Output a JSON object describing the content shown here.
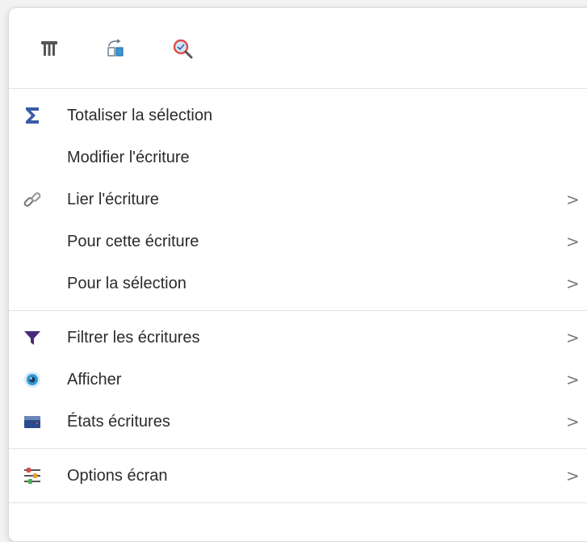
{
  "toolbar": {
    "buttons": [
      {
        "icon": "column-icon"
      },
      {
        "icon": "document-sync-icon"
      },
      {
        "icon": "search-magnifier-icon"
      }
    ]
  },
  "menu": {
    "sections": [
      {
        "items": [
          {
            "label": "Totaliser la sélection",
            "icon": "sigma-icon",
            "submenu": false
          },
          {
            "label": "Modifier l'écriture",
            "icon": "",
            "submenu": false
          },
          {
            "label": "Lier l'écriture",
            "icon": "link-chain-icon",
            "submenu": true
          },
          {
            "label": "Pour cette écriture",
            "icon": "",
            "submenu": true
          },
          {
            "label": "Pour la sélection",
            "icon": "",
            "submenu": true
          }
        ]
      },
      {
        "items": [
          {
            "label": "Filtrer les écritures",
            "icon": "filter-funnel-icon",
            "submenu": true
          },
          {
            "label": "Afficher",
            "icon": "eye-icon",
            "submenu": true
          },
          {
            "label": "États écritures",
            "icon": "printer-icon",
            "submenu": true
          }
        ]
      },
      {
        "items": [
          {
            "label": "Options écran",
            "icon": "sliders-icon",
            "submenu": true
          }
        ]
      }
    ],
    "chevron": ">"
  },
  "colors": {
    "sigma": "#3a5ba8",
    "filter": "#4a2a7a",
    "eye_outer": "#2f9bd3",
    "printer": "#2a4c8c",
    "magnifier": "#e24b4b"
  }
}
